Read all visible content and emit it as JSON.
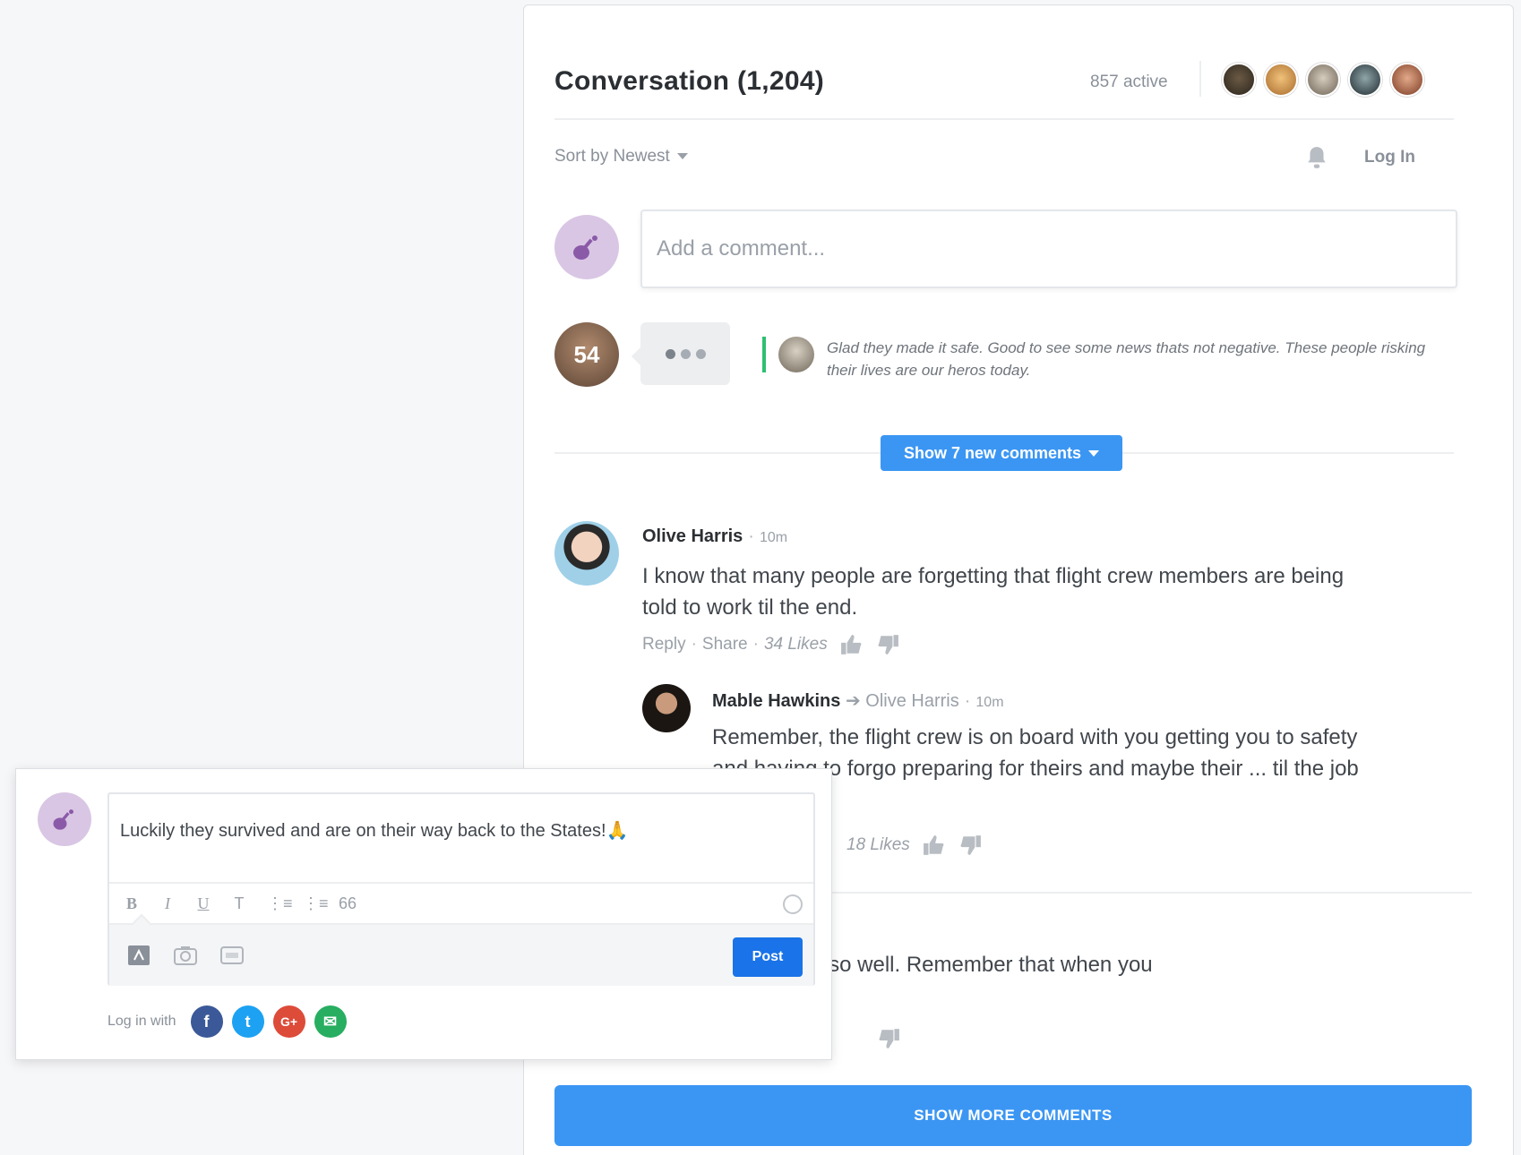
{
  "header": {
    "title": "Conversation (1,204)",
    "active": "857 active",
    "avatars": [
      {
        "name": "user-1",
        "color": "#3b3a2e"
      },
      {
        "name": "user-2",
        "color": "#c98b3e"
      },
      {
        "name": "user-3",
        "color": "#8c8172"
      },
      {
        "name": "user-4",
        "color": "#1f2a30"
      },
      {
        "name": "user-5",
        "color": "#a0583a"
      }
    ]
  },
  "sort": {
    "label": "Sort by Newest"
  },
  "login": {
    "label": "Log In"
  },
  "composer": {
    "placeholder": "Add a comment..."
  },
  "typing": {
    "count": "54",
    "preview": "Glad they made it safe. Good to see some news thats not negative. These people risking their lives are our heros today."
  },
  "new_comments": {
    "label": "Show 7 new comments"
  },
  "comments": [
    {
      "author": "Olive Harris",
      "time": "10m",
      "body": "I know that many people are forgetting that flight crew members are being told to work til the end.",
      "reply": "Reply",
      "share": "Share",
      "likes": "34 Likes"
    },
    {
      "author": "Mable Hawkins",
      "reply_to": "Olive Harris",
      "time": "10m",
      "body": "Remember, the flight crew is on board with you getting you to safety and having to forgo preparing for theirs and maybe their ... til the job is done.",
      "likes": "18 Likes"
    }
  ],
  "third_comment_fragment": "onal pilots are paid so well. Remember that when you",
  "show_more": {
    "label": "SHOW MORE COMMENTS"
  },
  "reply_editor": {
    "text": "Luckily they survived and are on their way back to the States!🙏",
    "toolbar": [
      "B",
      "I",
      "U",
      "T",
      "⋮≡",
      "⋮≡",
      "66"
    ],
    "post_label": "Post",
    "login_label": "Log in with",
    "social": [
      {
        "name": "facebook",
        "glyph": "f",
        "color": "#3b5998"
      },
      {
        "name": "twitter",
        "glyph": "t",
        "color": "#1da1f2"
      },
      {
        "name": "google-plus",
        "glyph": "G+",
        "color": "#dd4b39"
      },
      {
        "name": "email",
        "glyph": "✉",
        "color": "#27ae60"
      }
    ]
  },
  "colors": {
    "accent": "#3b96f3",
    "post": "#1a73e8",
    "typing_bar": "#2fbf71",
    "avatar_bg": "#d9c6e4"
  }
}
